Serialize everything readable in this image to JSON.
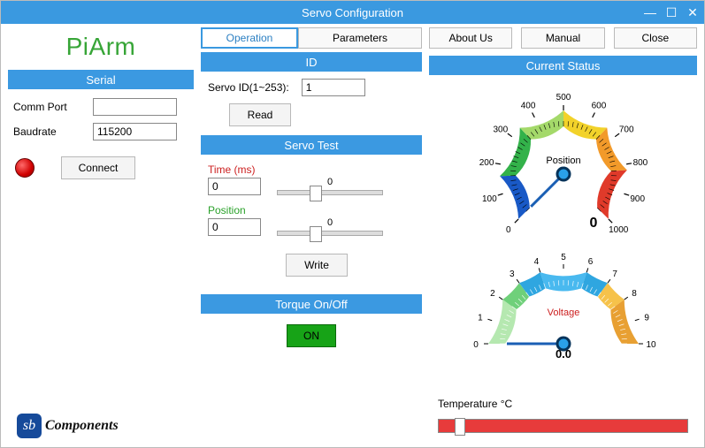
{
  "window": {
    "title": "Servo Configuration"
  },
  "brand": "PiArm",
  "tabs": {
    "operation": "Operation",
    "parameters": "Parameters",
    "about": "About Us",
    "manual": "Manual",
    "close": "Close"
  },
  "serial": {
    "header": "Serial",
    "comm_port_label": "Comm Port",
    "comm_port_value": "",
    "baud_label": "Baudrate",
    "baud_value": "115200",
    "connect_label": "Connect"
  },
  "id": {
    "header": "ID",
    "label": "Servo ID(1~253):",
    "value": "1",
    "read_label": "Read"
  },
  "servo_test": {
    "header": "Servo Test",
    "time_label": "Time (ms)",
    "time_value": "0",
    "time_slider": "0",
    "pos_label": "Position",
    "pos_value": "0",
    "pos_slider": "0",
    "write_label": "Write"
  },
  "torque": {
    "header": "Torque On/Off",
    "btn": "ON"
  },
  "status": {
    "header": "Current Status",
    "position_title": "Position",
    "position_value": "0",
    "position_ticks": [
      "0",
      "100",
      "200",
      "300",
      "400",
      "500",
      "600",
      "700",
      "800",
      "900",
      "1000"
    ],
    "voltage_title": "Voltage",
    "voltage_value": "0.0",
    "voltage_ticks": [
      "0",
      "1",
      "2",
      "3",
      "4",
      "5",
      "6",
      "7",
      "8",
      "9",
      "10"
    ],
    "temperature_label": "Temperature °C"
  },
  "logo": {
    "box": "sb",
    "text": "Components"
  },
  "chart_data": [
    {
      "type": "other",
      "subtype": "radial-gauge",
      "title": "Position",
      "range": [
        0,
        1000
      ],
      "ticks": [
        0,
        100,
        200,
        300,
        400,
        500,
        600,
        700,
        800,
        900,
        1000
      ],
      "value": 0,
      "band_colors": [
        {
          "from": 0,
          "to": 160,
          "color": "#1959c6"
        },
        {
          "from": 160,
          "to": 340,
          "color": "#33b24a"
        },
        {
          "from": 340,
          "to": 500,
          "color": "#a4d96a"
        },
        {
          "from": 500,
          "to": 660,
          "color": "#f2d22a"
        },
        {
          "from": 660,
          "to": 820,
          "color": "#f29a2a"
        },
        {
          "from": 820,
          "to": 1000,
          "color": "#e03a2a"
        }
      ],
      "start_angle_deg": 225,
      "end_angle_deg": -45
    },
    {
      "type": "other",
      "subtype": "radial-gauge-half",
      "title": "Voltage",
      "range": [
        0,
        10
      ],
      "ticks": [
        0,
        1,
        2,
        3,
        4,
        5,
        6,
        7,
        8,
        9,
        10
      ],
      "value": 0.0,
      "band_colors": [
        {
          "from": 0,
          "to": 2,
          "color": "#b5e8b0"
        },
        {
          "from": 2,
          "to": 3,
          "color": "#6fd07a"
        },
        {
          "from": 3,
          "to": 4,
          "color": "#2fa6e0"
        },
        {
          "from": 4,
          "to": 6,
          "color": "#49b9ef"
        },
        {
          "from": 6,
          "to": 7,
          "color": "#2fa6e0"
        },
        {
          "from": 7,
          "to": 8,
          "color": "#f6c24a"
        },
        {
          "from": 8,
          "to": 10,
          "color": "#e8a033"
        }
      ],
      "start_angle_deg": 180,
      "end_angle_deg": 0
    },
    {
      "type": "other",
      "subtype": "linear-bar",
      "title": "Temperature °C",
      "range": [
        0,
        100
      ],
      "value": 0
    }
  ]
}
